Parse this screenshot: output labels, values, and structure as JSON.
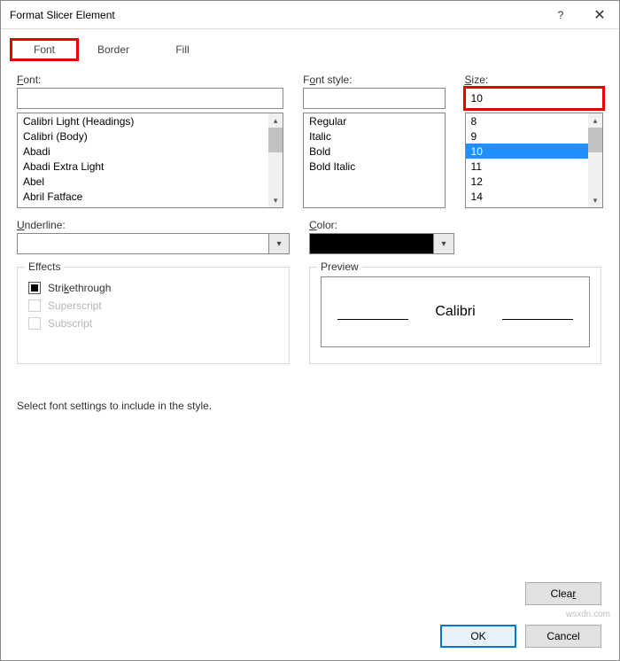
{
  "window": {
    "title": "Format Slicer Element"
  },
  "tabs": {
    "font": "Font",
    "border": "Border",
    "fill": "Fill",
    "active": "font"
  },
  "labels": {
    "font": "Font:",
    "fontstyle": "Font style:",
    "size": "Size:",
    "underline": "Underline:",
    "color": "Color:",
    "effects": "Effects",
    "preview": "Preview",
    "strike": "Strikethrough",
    "super": "Superscript",
    "sub": "Subscript"
  },
  "font": {
    "value": "",
    "items": [
      "Calibri Light (Headings)",
      "Calibri (Body)",
      "Abadi",
      "Abadi Extra Light",
      "Abel",
      "Abril Fatface"
    ]
  },
  "style": {
    "value": "",
    "items": [
      "Regular",
      "Italic",
      "Bold",
      "Bold Italic"
    ]
  },
  "size": {
    "value": "10",
    "selected": "10",
    "items": [
      "8",
      "9",
      "10",
      "11",
      "12",
      "14"
    ]
  },
  "underline": {
    "value": ""
  },
  "color": {
    "value": "#000000"
  },
  "effects": {
    "strike": true,
    "super": false,
    "sub": false,
    "super_enabled": false,
    "sub_enabled": false
  },
  "preview": {
    "text": "Calibri"
  },
  "hint": "Select font settings to include in the style.",
  "buttons": {
    "clear": "Clear",
    "ok": "OK",
    "cancel": "Cancel"
  },
  "highlight": {
    "font_tab": true,
    "size_input": true
  },
  "watermark": "wsxdn.com"
}
